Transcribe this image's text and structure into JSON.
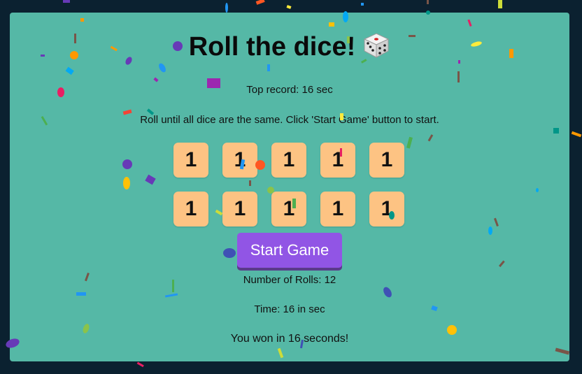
{
  "page": {
    "title": "Roll the dice!",
    "record": "Top record: 16 sec",
    "instructions": "Roll until all dice are the same. Click 'Start Game' button to start.",
    "dice": [
      "1",
      "1",
      "1",
      "1",
      "1",
      "1",
      "1",
      "1",
      "1",
      "1"
    ],
    "start_button": "Start Game",
    "rolls": "Number of Rolls: 12",
    "time": "Time: 16 in sec",
    "result": "You won in 16 seconds!"
  },
  "colors": {
    "background": "#0b2130",
    "card": "#55b8a6",
    "die": "#fdc383",
    "button": "#9155e5"
  },
  "icons": {
    "title_icon": "die-icon",
    "decoration": "confetti"
  }
}
